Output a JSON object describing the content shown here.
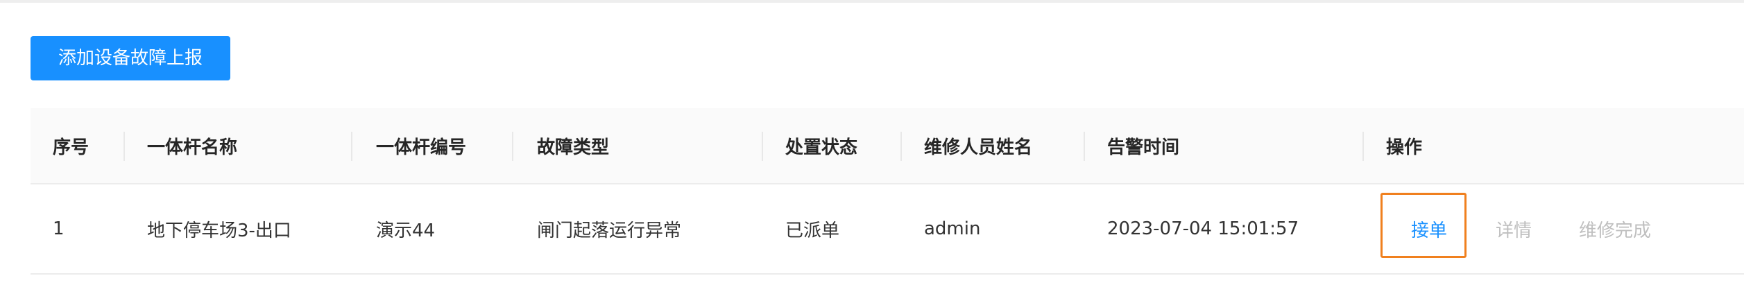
{
  "toolbar": {
    "add_button_label": "添加设备故障上报"
  },
  "table": {
    "columns": [
      "序号",
      "一体杆名称",
      "一体杆编号",
      "故障类型",
      "处置状态",
      "维修人员姓名",
      "告警时间",
      "操作"
    ],
    "rows": [
      {
        "index": "1",
        "pole_name": "地下停车场3-出口",
        "pole_code": "演示44",
        "fault_type": "闸门起落运行异常",
        "status": "已派单",
        "repair_person": "admin",
        "alarm_time": "2023-07-04 15:01:57",
        "actions": {
          "accept": "接单",
          "detail": "详情",
          "complete": "维修完成"
        }
      }
    ]
  },
  "colors": {
    "primary": "#1890ff",
    "highlight": "#f0801e",
    "disabled_text": "#bfbfbf",
    "header_bg": "#fafafa"
  }
}
